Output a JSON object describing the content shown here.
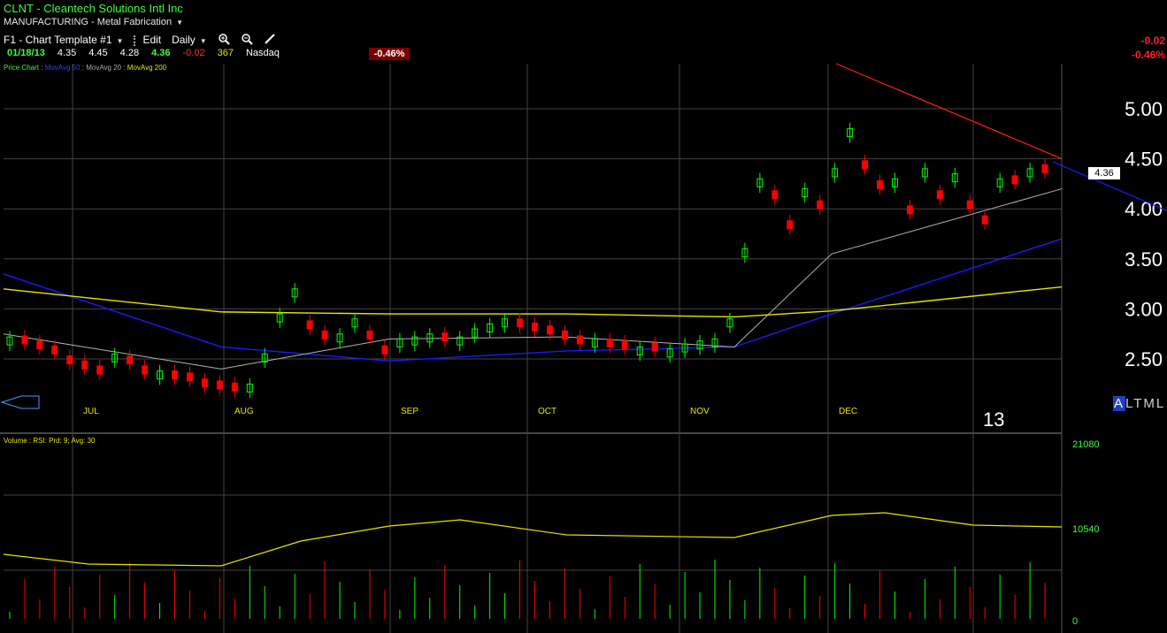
{
  "header": {
    "symbol_line": "CLNT - Cleantech Solutions Intl Inc",
    "sector_line": "MANUFACTURING - Metal Fabrication",
    "template": "F1 - Chart Template #1",
    "edit_label": "Edit",
    "period_label": "Daily",
    "quote": {
      "date": "01/18/13",
      "open": "4.35",
      "high": "4.45",
      "low": "4.28",
      "close": "4.36",
      "change": "-0.02",
      "volume": "367",
      "exchange": "Nasdaq",
      "pct": "-0.46%"
    },
    "right_change": "-0.02",
    "right_pct": "-0.46%"
  },
  "legend": {
    "price_chart": "Price Chart",
    "ma50": "MovAvg 50",
    "ma20": "MovAvg 20",
    "ma200": "MovAvg 200",
    "volume_panel": "Volume : RSI: Prd: 9; Avg: 30"
  },
  "overlays": {
    "last_price_flag": "4.36",
    "year_label": "13",
    "altml_a": "A",
    "altml_rest": "LTML"
  },
  "colors": {
    "up": "#00ff00",
    "down": "#ff0000",
    "ma50": "#1a1aff",
    "ma20": "#b4b4b4",
    "ma200": "#e6e600",
    "trendline_down": "#ff2020",
    "trendline_up": "#1a1aff",
    "grid": "#444444"
  },
  "chart_data": {
    "type": "line",
    "title": "CLNT - Cleantech Solutions Intl Inc",
    "price_axis_ticks": [
      "5.00",
      "4.50",
      "4.00",
      "3.50",
      "3.00",
      "2.50"
    ],
    "volume_axis_ticks": [
      "21080",
      "10540",
      "0"
    ],
    "month_labels": [
      "JUL",
      "AUG",
      "SEP",
      "OCT",
      "NOV",
      "DEC"
    ],
    "ylim": [
      2.05,
      5.45
    ],
    "x": [
      "2012-07",
      "2012-08",
      "2012-09",
      "2012-10",
      "2012-11",
      "2012-12",
      "2013-01"
    ],
    "series": [
      {
        "name": "MovAvg 50",
        "values": [
          3.35,
          2.62,
          2.48,
          2.58,
          2.62,
          2.95,
          3.7
        ]
      },
      {
        "name": "MovAvg 20",
        "values": [
          2.75,
          2.4,
          2.7,
          2.72,
          2.62,
          3.55,
          4.2
        ]
      },
      {
        "name": "MovAvg 200",
        "values": [
          3.2,
          2.97,
          2.95,
          2.95,
          2.92,
          2.98,
          3.22
        ]
      }
    ],
    "candles_close": [
      2.72,
      2.65,
      2.6,
      2.55,
      2.45,
      2.4,
      2.35,
      2.55,
      2.45,
      2.35,
      2.38,
      2.3,
      2.28,
      2.22,
      2.2,
      2.18,
      2.25,
      2.55,
      2.95,
      3.2,
      2.8,
      2.7,
      2.75,
      2.9,
      2.7,
      2.55,
      2.7,
      2.72,
      2.75,
      2.68,
      2.72,
      2.8,
      2.85,
      2.9,
      2.82,
      2.78,
      2.75,
      2.7,
      2.65,
      2.7,
      2.62,
      2.6,
      2.62,
      2.58,
      2.6,
      2.65,
      2.68,
      2.7,
      2.9,
      3.6,
      4.3,
      4.1,
      3.8,
      4.2,
      4.0,
      4.4,
      4.8,
      4.4,
      4.2,
      4.3,
      3.95,
      4.4,
      4.1,
      4.35,
      4.0,
      3.85,
      4.3,
      4.25,
      4.4,
      4.36
    ],
    "candles_up": [
      true,
      false,
      false,
      false,
      false,
      false,
      false,
      true,
      false,
      false,
      true,
      false,
      false,
      false,
      false,
      false,
      true,
      true,
      true,
      true,
      false,
      false,
      true,
      true,
      false,
      false,
      true,
      true,
      true,
      false,
      true,
      true,
      true,
      true,
      false,
      false,
      false,
      false,
      false,
      true,
      false,
      false,
      true,
      false,
      true,
      true,
      true,
      true,
      true,
      true,
      true,
      false,
      false,
      true,
      false,
      true,
      true,
      false,
      false,
      true,
      false,
      true,
      false,
      true,
      false,
      false,
      true,
      false,
      true,
      false
    ],
    "volume_scale_max": 21080
  }
}
